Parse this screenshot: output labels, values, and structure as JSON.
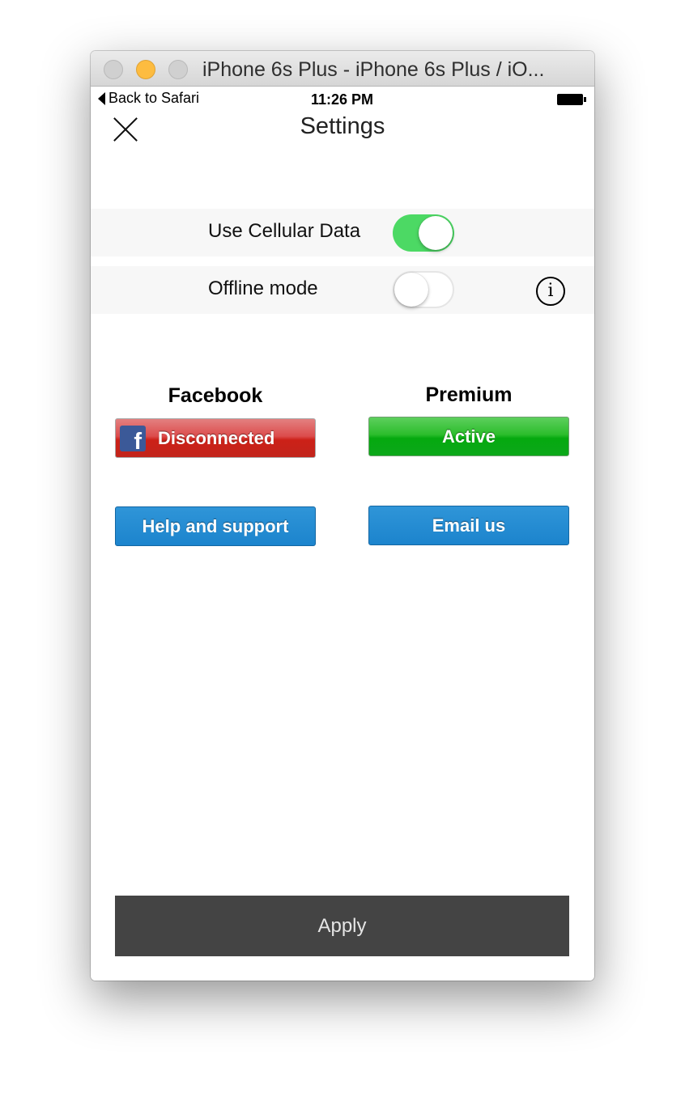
{
  "window": {
    "title": "iPhone 6s Plus - iPhone 6s Plus / iO..."
  },
  "status_bar": {
    "back_label": "Back to Safari",
    "time": "11:26 PM"
  },
  "header": {
    "title": "Settings"
  },
  "settings": {
    "cellular": {
      "label": "Use Cellular Data",
      "enabled": true
    },
    "offline": {
      "label": "Offline mode",
      "enabled": false
    }
  },
  "facebook": {
    "heading": "Facebook",
    "button_label": "Disconnected",
    "icon_letter": "f"
  },
  "premium": {
    "heading": "Premium",
    "button_label": "Active"
  },
  "support": {
    "help_label": "Help and support",
    "email_label": "Email us"
  },
  "footer": {
    "apply_label": "Apply"
  },
  "colors": {
    "toggle_on": "#4cd964",
    "facebook_red": "#cc2118",
    "premium_green": "#05a90f",
    "action_blue": "#1c84cd",
    "apply_bg": "#444444"
  }
}
